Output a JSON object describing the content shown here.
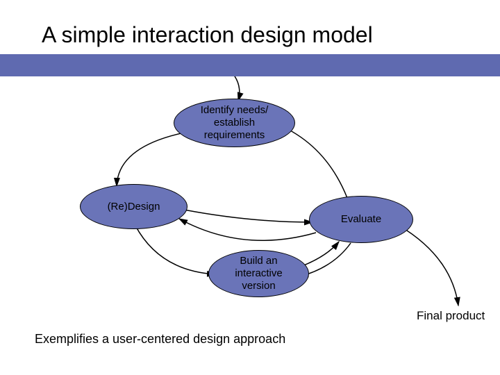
{
  "title": "A simple interaction design model",
  "nodes": {
    "identify": "Identify needs/\nestablish\nrequirements",
    "redesign": "(Re)Design",
    "evaluate": "Evaluate",
    "build": "Build an\ninteractive\nversion"
  },
  "final_label": "Final product",
  "caption": "Exemplifies a user-centered design approach",
  "colors": {
    "accent": "#6a74b8",
    "bar": "#5f6ab0"
  }
}
